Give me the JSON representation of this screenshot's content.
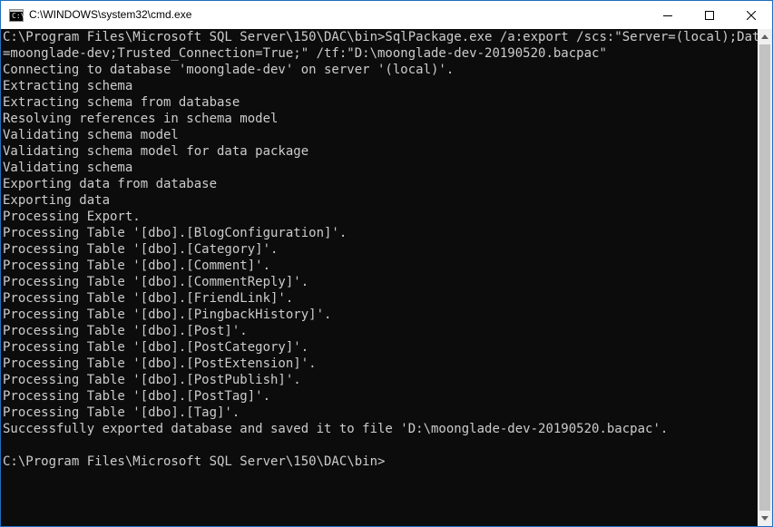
{
  "window": {
    "title": "C:\\WINDOWS\\system32\\cmd.exe",
    "icon": "cmd-icon",
    "icon_glyph": "C:\\",
    "controls": [
      "minimize-icon",
      "maximize-icon",
      "close-icon"
    ]
  },
  "console": {
    "lines": [
      "C:\\Program Files\\Microsoft SQL Server\\150\\DAC\\bin>SqlPackage.exe /a:export /scs:\"Server=(local);Database",
      "=moonglade-dev;Trusted_Connection=True;\" /tf:\"D:\\moonglade-dev-20190520.bacpac\"",
      "Connecting to database 'moonglade-dev' on server '(local)'.",
      "Extracting schema",
      "Extracting schema from database",
      "Resolving references in schema model",
      "Validating schema model",
      "Validating schema model for data package",
      "Validating schema",
      "Exporting data from database",
      "Exporting data",
      "Processing Export.",
      "Processing Table '[dbo].[BlogConfiguration]'.",
      "Processing Table '[dbo].[Category]'.",
      "Processing Table '[dbo].[Comment]'.",
      "Processing Table '[dbo].[CommentReply]'.",
      "Processing Table '[dbo].[FriendLink]'.",
      "Processing Table '[dbo].[PingbackHistory]'.",
      "Processing Table '[dbo].[Post]'.",
      "Processing Table '[dbo].[PostCategory]'.",
      "Processing Table '[dbo].[PostExtension]'.",
      "Processing Table '[dbo].[PostPublish]'.",
      "Processing Table '[dbo].[PostTag]'.",
      "Processing Table '[dbo].[Tag]'.",
      "Successfully exported database and saved it to file 'D:\\moonglade-dev-20190520.bacpac'.",
      "",
      "C:\\Program Files\\Microsoft SQL Server\\150\\DAC\\bin>"
    ]
  },
  "scrollbar": {
    "up_icon": "scroll-up-arrow-icon",
    "down_icon": "scroll-down-arrow-icon"
  },
  "colors": {
    "console_bg": "#0c0c0c",
    "console_fg": "#cccccc",
    "titlebar_bg": "#ffffff",
    "border": "#1f6fc0"
  }
}
